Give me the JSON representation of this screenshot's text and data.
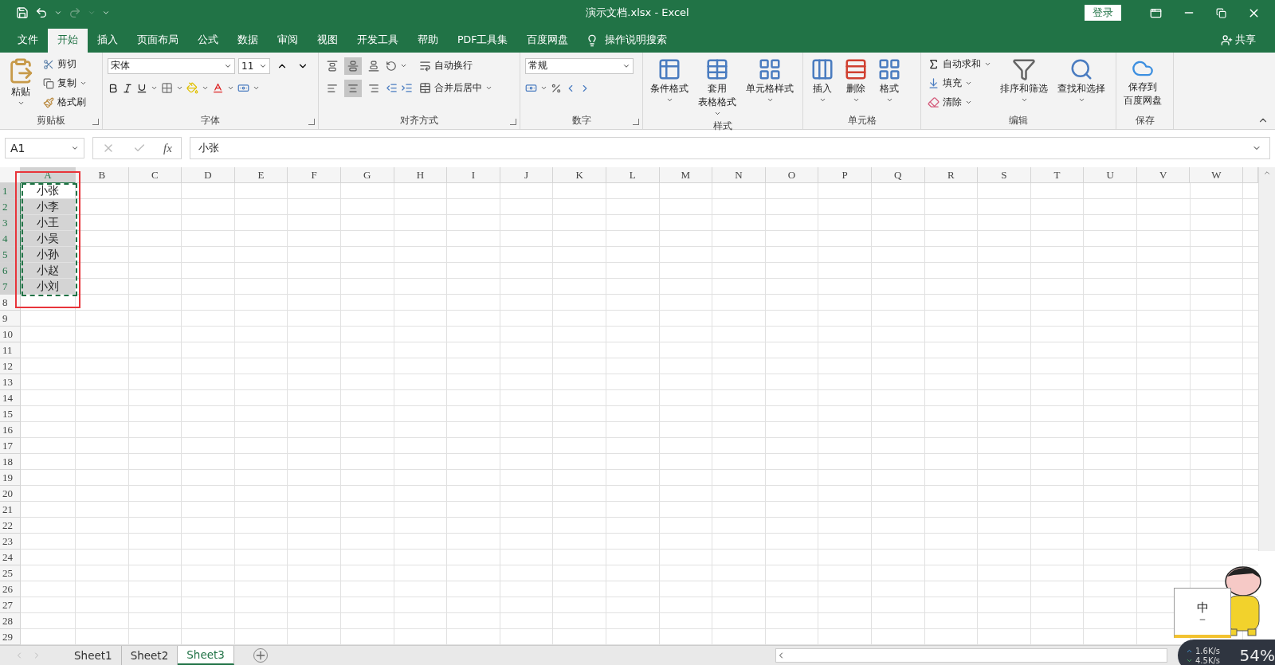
{
  "title_bar": {
    "title": "演示文档.xlsx  -  Excel",
    "login_button": "登录"
  },
  "menu_tabs": [
    {
      "label": "文件",
      "selected": false
    },
    {
      "label": "开始",
      "selected": true
    },
    {
      "label": "插入",
      "selected": false
    },
    {
      "label": "页面布局",
      "selected": false
    },
    {
      "label": "公式",
      "selected": false
    },
    {
      "label": "数据",
      "selected": false
    },
    {
      "label": "审阅",
      "selected": false
    },
    {
      "label": "视图",
      "selected": false
    },
    {
      "label": "开发工具",
      "selected": false
    },
    {
      "label": "帮助",
      "selected": false
    },
    {
      "label": "PDF工具集",
      "selected": false
    },
    {
      "label": "百度网盘",
      "selected": false
    }
  ],
  "tell_me": "操作说明搜索",
  "share": "共享",
  "ribbon": {
    "clipboard": {
      "label": "剪贴板",
      "paste": "粘贴",
      "cut": "剪切",
      "copy": "复制",
      "format_painter": "格式刷"
    },
    "font": {
      "label": "字体",
      "font_name": "宋体",
      "font_size": "11"
    },
    "alignment": {
      "label": "对齐方式",
      "wrap_text": "自动换行",
      "merge_center": "合并后居中",
      "vertical": [
        {
          "kind": "top",
          "selected": false
        },
        {
          "kind": "middle",
          "selected": true
        },
        {
          "kind": "bottom",
          "selected": false
        }
      ],
      "horizontal": [
        {
          "kind": "left",
          "selected": false
        },
        {
          "kind": "center",
          "selected": true
        },
        {
          "kind": "right",
          "selected": false
        }
      ]
    },
    "number": {
      "label": "数字",
      "format": "常规"
    },
    "styles": {
      "label": "样式",
      "buttons": [
        {
          "kind": "conditional",
          "lines": [
            "条件格式"
          ]
        },
        {
          "kind": "table",
          "lines": [
            "套用",
            "表格格式"
          ]
        },
        {
          "kind": "cell",
          "lines": [
            "单元格样式"
          ]
        }
      ]
    },
    "cells": {
      "label": "单元格",
      "buttons": [
        {
          "kind": "insert",
          "label": "插入"
        },
        {
          "kind": "delete",
          "label": "删除"
        },
        {
          "kind": "format",
          "label": "格式"
        }
      ]
    },
    "editing": {
      "label": "编辑",
      "autosum": "自动求和",
      "fill": "填充",
      "clear": "清除",
      "sort_filter": "排序和筛选",
      "find_select": "查找和选择"
    },
    "save": {
      "label": "保存",
      "lines": [
        "保存到",
        "百度网盘"
      ]
    }
  },
  "formula_bar": {
    "name_box": "A1",
    "function_label": "fx",
    "content": "小张"
  },
  "columns": [
    {
      "label": "A",
      "selected": true
    },
    {
      "label": "B",
      "selected": false
    },
    {
      "label": "C",
      "selected": false
    },
    {
      "label": "D",
      "selected": false
    },
    {
      "label": "E",
      "selected": false
    },
    {
      "label": "F",
      "selected": false
    },
    {
      "label": "G",
      "selected": false
    },
    {
      "label": "H",
      "selected": false
    },
    {
      "label": "I",
      "selected": false
    },
    {
      "label": "J",
      "selected": false
    },
    {
      "label": "K",
      "selected": false
    },
    {
      "label": "L",
      "selected": false
    },
    {
      "label": "M",
      "selected": false
    },
    {
      "label": "N",
      "selected": false
    },
    {
      "label": "O",
      "selected": false
    },
    {
      "label": "P",
      "selected": false
    },
    {
      "label": "Q",
      "selected": false
    },
    {
      "label": "R",
      "selected": false
    },
    {
      "label": "S",
      "selected": false
    },
    {
      "label": "T",
      "selected": false
    },
    {
      "label": "U",
      "selected": false
    },
    {
      "label": "V",
      "selected": false
    },
    {
      "label": "W",
      "selected": false
    }
  ],
  "rows": [
    {
      "header": "1",
      "selected": true,
      "active": true,
      "value": "小张"
    },
    {
      "header": "2",
      "selected": true,
      "active": false,
      "value": "小李"
    },
    {
      "header": "3",
      "selected": true,
      "active": false,
      "value": "小王"
    },
    {
      "header": "4",
      "selected": true,
      "active": false,
      "value": "小吴"
    },
    {
      "header": "5",
      "selected": true,
      "active": false,
      "value": "小孙"
    },
    {
      "header": "6",
      "selected": true,
      "active": false,
      "value": "小赵"
    },
    {
      "header": "7",
      "selected": true,
      "active": false,
      "value": "小刘"
    },
    {
      "header": "8",
      "selected": false
    },
    {
      "header": "9",
      "selected": false
    },
    {
      "header": "10",
      "selected": false
    },
    {
      "header": "11",
      "selected": false
    },
    {
      "header": "12",
      "selected": false
    },
    {
      "header": "13",
      "selected": false
    },
    {
      "header": "14",
      "selected": false
    },
    {
      "header": "15",
      "selected": false
    },
    {
      "header": "16",
      "selected": false
    },
    {
      "header": "17",
      "selected": false
    },
    {
      "header": "18",
      "selected": false
    },
    {
      "header": "19",
      "selected": false
    },
    {
      "header": "20",
      "selected": false
    },
    {
      "header": "21",
      "selected": false
    },
    {
      "header": "22",
      "selected": false
    },
    {
      "header": "23",
      "selected": false
    },
    {
      "header": "24",
      "selected": false
    },
    {
      "header": "25",
      "selected": false
    },
    {
      "header": "26",
      "selected": false
    },
    {
      "header": "27",
      "selected": false
    },
    {
      "header": "28",
      "selected": false
    },
    {
      "header": "29",
      "selected": false
    }
  ],
  "sheets": [
    {
      "label": "Sheet1",
      "selected": false
    },
    {
      "label": "Sheet2",
      "selected": false
    },
    {
      "label": "Sheet3",
      "selected": true
    }
  ],
  "desktop_widget": {
    "ime_mode": "中",
    "upload_speed": "1.6K/s",
    "download_speed": "4.5K/s",
    "usage": "54%"
  }
}
